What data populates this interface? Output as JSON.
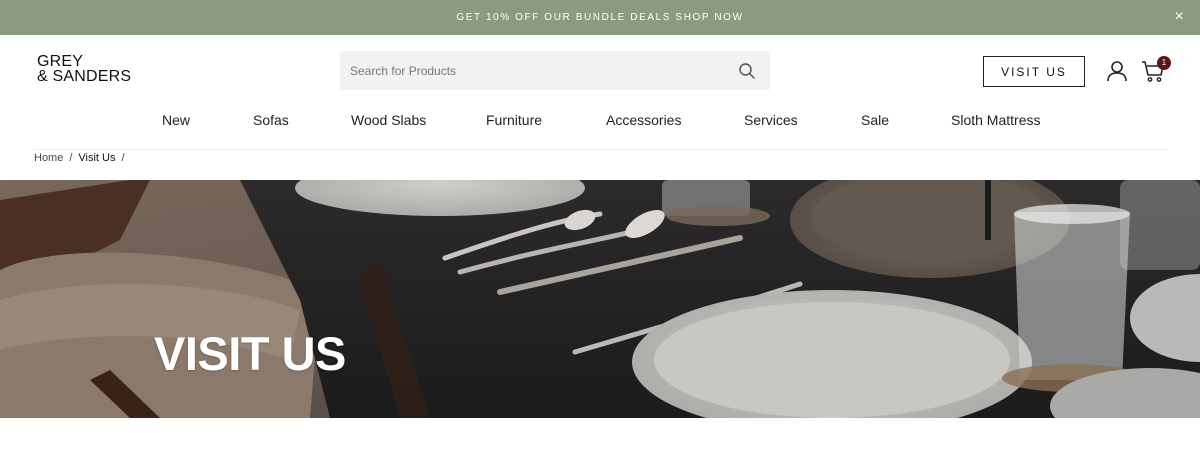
{
  "promo": {
    "text": "GET 10% OFF OUR BUNDLE DEALS SHOP NOW",
    "close_icon": "close-icon"
  },
  "brand": {
    "line1": "GREY",
    "line2": "& SANDERS"
  },
  "search": {
    "placeholder": "Search for Products",
    "value": "",
    "icon": "search-icon"
  },
  "header": {
    "visit_button": "VISIT US",
    "cart_count": "1"
  },
  "nav": [
    "New",
    "Sofas",
    "Wood Slabs",
    "Furniture",
    "Accessories",
    "Services",
    "Sale",
    "Sloth Mattress"
  ],
  "breadcrumb": {
    "home": "Home",
    "sep1": "/",
    "current": "Visit Us",
    "sep2": "/"
  },
  "hero": {
    "title": "VISIT US"
  },
  "colors": {
    "promo_bg": "#8b9a80",
    "badge_bg": "#5a1a12"
  }
}
